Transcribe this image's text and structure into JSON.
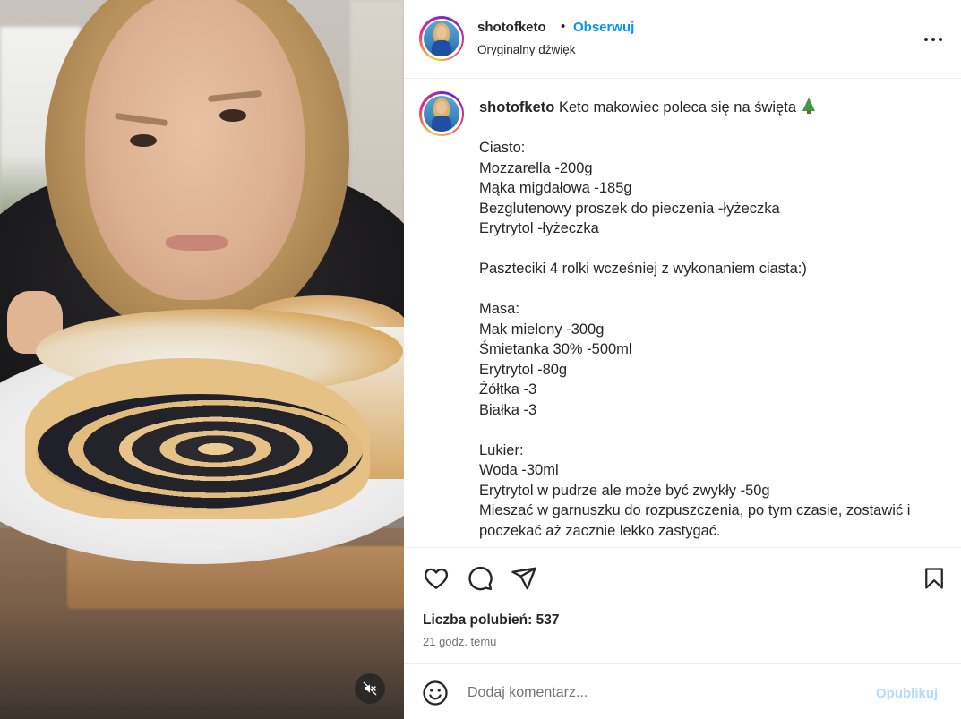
{
  "post": {
    "username": "shotofketo",
    "dot": "•",
    "follow_label": "Obserwuj",
    "audio_label": "Oryginalny dźwięk",
    "caption_first": "Keto makowiec poleca się na święta",
    "caption_lines": [
      "",
      "Ciasto:",
      "Mozzarella -200g",
      "Mąka migdałowa -185g",
      "Bezglutenowy proszek do pieczenia -łyżeczka",
      "Erytrytol -łyżeczka",
      "",
      "Paszteciki 4 rolki wcześniej z wykonaniem ciasta:)",
      "",
      "Masa:",
      "Mak mielony -300g",
      "Śmietanka 30% -500ml",
      "Erytrytol -80g",
      "Żółtka -3",
      "Białka -3",
      "",
      "Lukier:",
      "Woda -30ml",
      "Erytrytol w pudrze ale może być zwykły -50g",
      "Mieszać w garnuszku do rozpuszczenia, po tym czasie, zostawić i poczekać aż zacznie lekko zastygać."
    ],
    "likes_label": "Liczba polubień: 537",
    "time_label": "21 godz. temu"
  },
  "comment": {
    "placeholder": "Dodaj komentarz...",
    "publish_label": "Opublikuj"
  },
  "icons": {
    "mute": "speaker-muted-icon",
    "like": "heart-icon",
    "comment": "comment-bubble-icon",
    "share": "paper-plane-icon",
    "save": "bookmark-icon",
    "emoji": "smiley-icon",
    "more": "more-dots-icon",
    "caption_emoji": "christmas-tree-icon"
  },
  "colors": {
    "accent": "#0095f6",
    "publish_disabled": "#b3dbff",
    "text": "#262626",
    "muted_text": "#737373"
  }
}
